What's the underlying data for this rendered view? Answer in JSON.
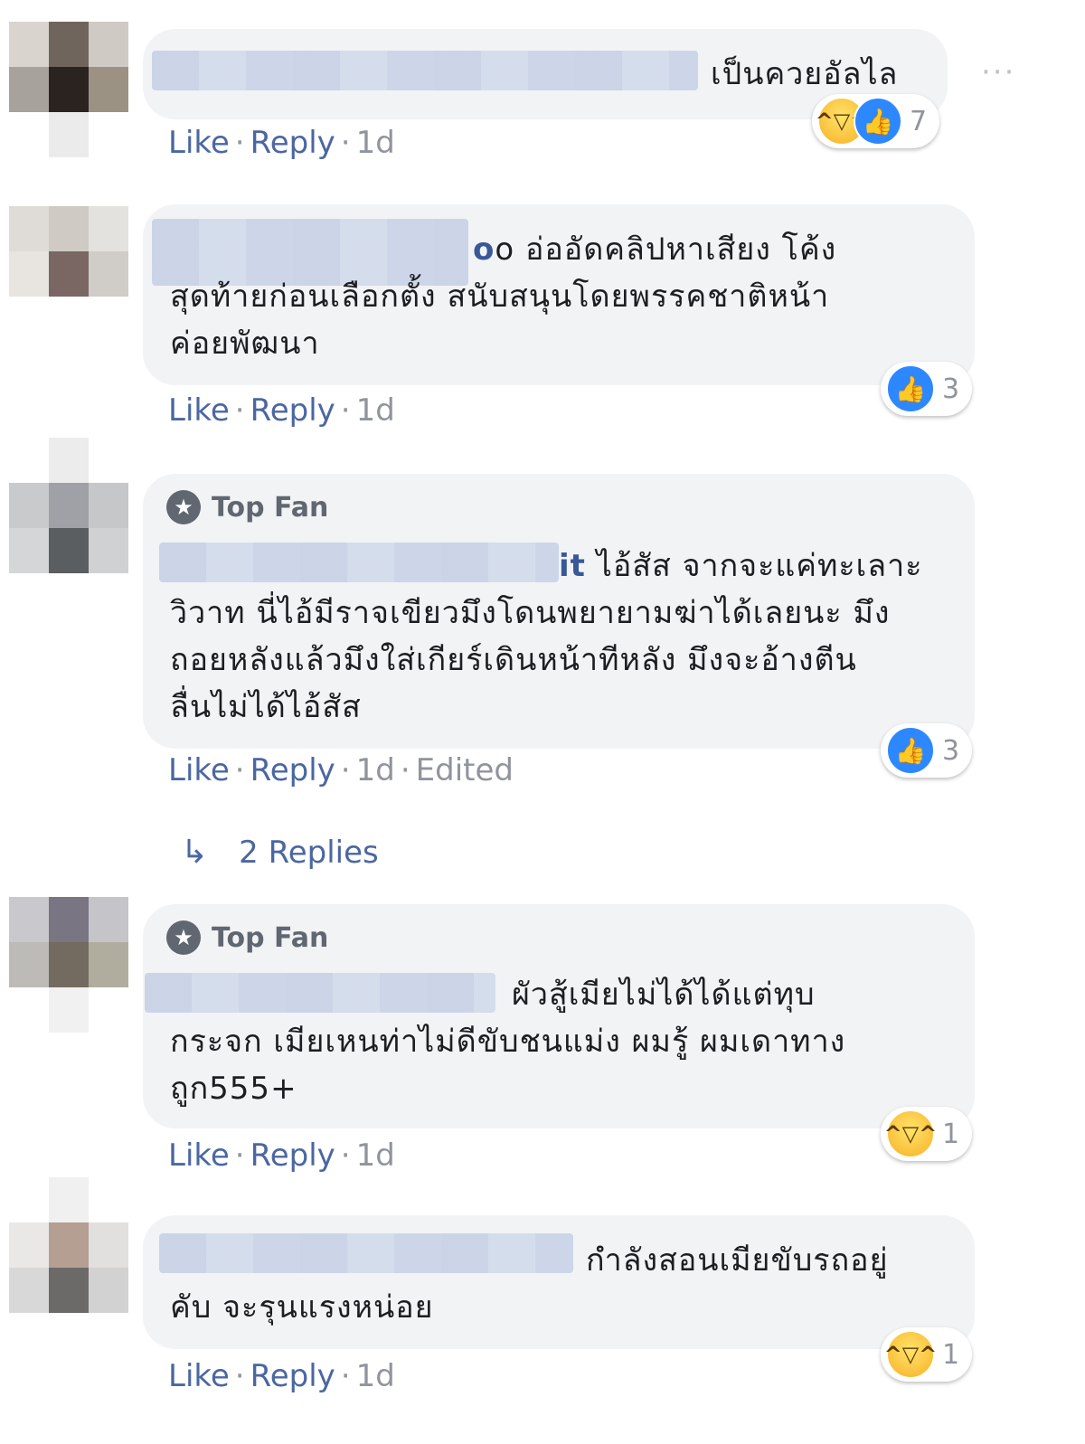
{
  "comments": [
    {
      "text_lines": [
        "เป็นควยอัลไล"
      ],
      "name_tail": "",
      "top_fan": "",
      "actions": {
        "like": "Like",
        "reply": "Reply",
        "time": "1d",
        "edited": ""
      },
      "reaction_count": "7"
    },
    {
      "text_lines": [
        "o อ่ออัดคลิปหาเสียง โค้ง",
        "สุดท้ายก่อนเลือกตั้ง สนับสนุนโดยพรรคชาติหน้า",
        "ค่อยพัฒนา"
      ],
      "name_tail": "o",
      "top_fan": "",
      "actions": {
        "like": "Like",
        "reply": "Reply",
        "time": "1d",
        "edited": ""
      },
      "reaction_count": "3"
    },
    {
      "text_lines": [
        "ไอ้สัส จากจะแค่ทะเลาะ",
        "วิวาท นี่ไอ้มีราจเขียวมึงโดนพยายามฆ่าได้เลยนะ มึง",
        "ถอยหลังแล้วมึงใส่เกียร์เดินหน้าทีหลัง มึงจะอ้างตีน",
        "ลื่นไม่ได้ไอ้สัส"
      ],
      "name_tail": "it",
      "top_fan": "Top Fan",
      "actions": {
        "like": "Like",
        "reply": "Reply",
        "time": "1d",
        "edited": "Edited"
      },
      "reaction_count": "3",
      "replies_label": "2 Replies"
    },
    {
      "text_lines": [
        "ผัวสู้เมียไม่ได้ได้แต่ทุบ",
        "กระจก เมียเหนท่าไม่ดีขับชนแม่ง ผมรู้ ผมเดาทาง",
        "ถูก555+"
      ],
      "name_tail": "",
      "top_fan": "Top Fan",
      "actions": {
        "like": "Like",
        "reply": "Reply",
        "time": "1d",
        "edited": ""
      },
      "reaction_count": "1"
    },
    {
      "text_lines": [
        "กำลังสอนเมียขับรถอยู่",
        "คับ จะรุนแรงหน่อย"
      ],
      "name_tail": "",
      "top_fan": "",
      "actions": {
        "like": "Like",
        "reply": "Reply",
        "time": "1d",
        "edited": ""
      },
      "reaction_count": "1"
    }
  ],
  "icons": {
    "more": "more-options-icon",
    "top_fan": "star-badge-icon",
    "like": "like-reaction-icon",
    "haha": "haha-reaction-icon",
    "reply_arrow": "reply-arrow-icon"
  },
  "colors": {
    "link": "#4b67a1",
    "name": "#385898",
    "bubble": "#f2f3f5",
    "meta": "#90949c"
  }
}
